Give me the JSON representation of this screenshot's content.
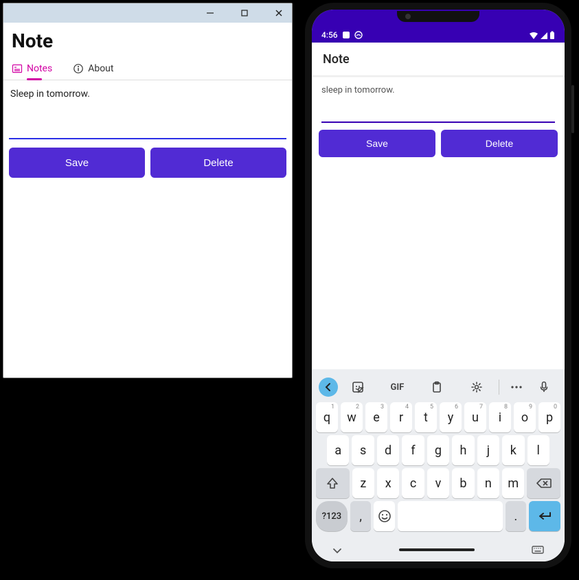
{
  "desktop": {
    "title": "Note",
    "tabs": [
      {
        "icon": "notes-icon",
        "label": "Notes",
        "active": true
      },
      {
        "icon": "info-icon",
        "label": "About",
        "active": false
      }
    ],
    "note_value": "Sleep in tomorrow.",
    "buttons": {
      "save": "Save",
      "delete": "Delete"
    }
  },
  "phone": {
    "status": {
      "time": "4:56"
    },
    "header": "Note",
    "note_value": "sleep in tomorrow.",
    "buttons": {
      "save": "Save",
      "delete": "Delete"
    },
    "keyboard": {
      "toolbar_gif": "GIF",
      "row1": [
        "q",
        "w",
        "e",
        "r",
        "t",
        "y",
        "u",
        "i",
        "o",
        "p"
      ],
      "row1_sup": [
        "1",
        "2",
        "3",
        "4",
        "5",
        "6",
        "7",
        "8",
        "9",
        "0"
      ],
      "row2": [
        "a",
        "s",
        "d",
        "f",
        "g",
        "h",
        "j",
        "k",
        "l"
      ],
      "row3": [
        "z",
        "x",
        "c",
        "v",
        "b",
        "n",
        "m"
      ],
      "symbols_key": "?123",
      "comma": ",",
      "period": "."
    }
  }
}
